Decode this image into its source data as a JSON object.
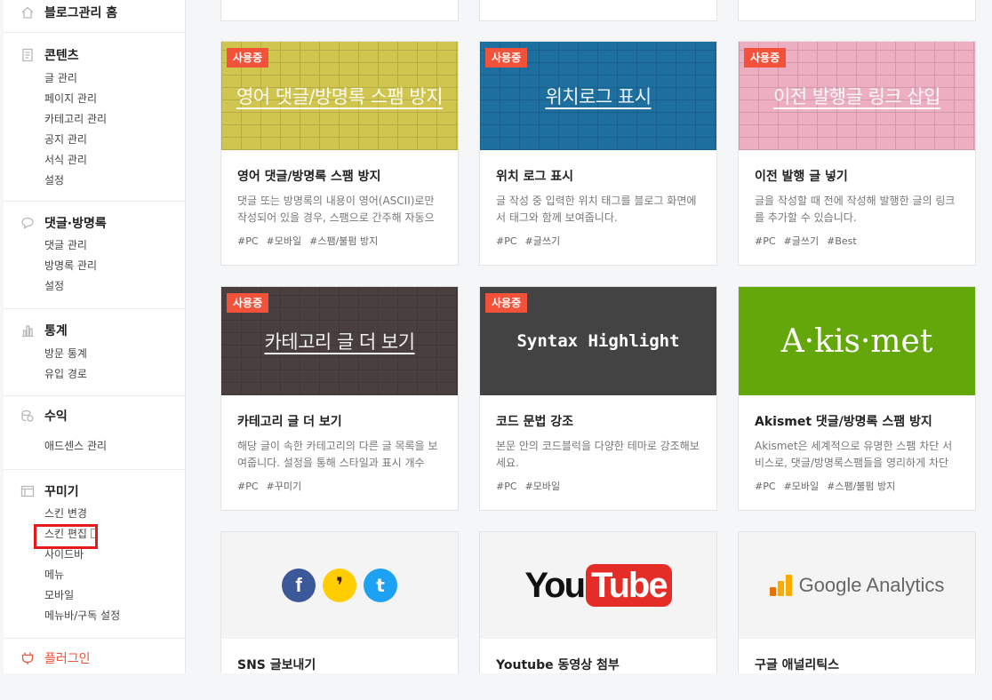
{
  "sidebar": {
    "home": "블로그관리 홈",
    "content": {
      "title": "콘텐츠",
      "items": [
        "글 관리",
        "페이지 관리",
        "카테고리 관리",
        "공지 관리",
        "서식 관리",
        "설정"
      ]
    },
    "comments": {
      "title": "댓글·방명록",
      "items": [
        "댓글 관리",
        "방명록 관리",
        "설정"
      ]
    },
    "stats": {
      "title": "통계",
      "items": [
        "방문 통계",
        "유입 경로"
      ]
    },
    "revenue": {
      "title": "수익",
      "items": [
        "애드센스 관리"
      ]
    },
    "decorate": {
      "title": "꾸미기",
      "items": [
        "스킨 변경",
        "스킨 편집",
        "사이드바",
        "메뉴",
        "모바일",
        "메뉴바/구독 설정"
      ]
    },
    "plugin": {
      "title": "플러그인"
    }
  },
  "badge_label": "사용중",
  "cards": [
    {
      "thumb_title": "영어 댓글/방명록 스팸 방지",
      "title": "영어 댓글/방명록 스팸 방지",
      "desc": "댓글 또는 방명록의 내용이 영어(ASCII)로만 작성되어 있을 경우, 스팸으로 간주해 자동으로…",
      "tags": [
        "#PC",
        "#모바일",
        "#스팸/불펌 방지"
      ],
      "color": "#d0c54f"
    },
    {
      "thumb_title": "위치로그 표시",
      "title": "위치 로그 표시",
      "desc": "글 작성 중 입력한 위치 태그를 블로그 화면에서 태그와 함께 보여줍니다.",
      "tags": [
        "#PC",
        "#글쓰기"
      ],
      "color": "#1d6fa0"
    },
    {
      "thumb_title": "이전 발행글 링크 삽입",
      "title": "이전 발행 글 넣기",
      "desc": "글을 작성할 때 전에 작성해 발행한 글의 링크를 추가할 수 있습니다.",
      "tags": [
        "#PC",
        "#글쓰기",
        "#Best"
      ],
      "color": "#eeaec2"
    },
    {
      "thumb_title": "카테고리 글 더 보기",
      "title": "카테고리 글 더 보기",
      "desc": "해당 글이 속한 카테고리의 다른 글 목록을 보여줍니다. 설정을 통해 스타일과 표시 개수를…",
      "tags": [
        "#PC",
        "#꾸미기"
      ],
      "color": "#4a3f3f"
    },
    {
      "thumb_title": "Syntax Highlight",
      "title": "코드 문법 강조",
      "desc": "본문 안의 코드블럭을 다양한 테마로 강조해보세요.",
      "tags": [
        "#PC",
        "#모바일"
      ],
      "color": "#434343"
    },
    {
      "thumb_title": "A·kis·met",
      "title": "Akismet 댓글/방명록 스팸 방지",
      "desc": "Akismet은 세계적으로 유명한 스팸 차단 서비스로, 댓글/방명록스팸들을 영리하게 차단해…",
      "tags": [
        "#PC",
        "#모바일",
        "#스팸/불펌 방지"
      ],
      "color": "#64a70b"
    },
    {
      "title": "SNS 글보내기",
      "icons": [
        "f",
        "❜",
        "t"
      ],
      "color": "#f4f4f4"
    },
    {
      "yt_you": "You",
      "yt_tube": "Tube",
      "title": "Youtube 동영상 첨부",
      "color": "#f4f4f4"
    },
    {
      "ga_text": "Google Analytics",
      "title": "구글 애널리틱스",
      "color": "#f4f4f4"
    }
  ]
}
